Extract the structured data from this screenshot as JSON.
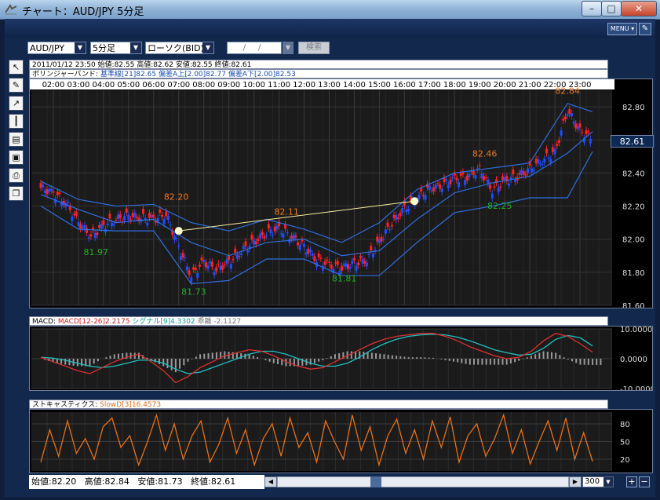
{
  "window": {
    "title": "チャート：AUD/JPY 5分足",
    "buttons": [
      "–",
      "□",
      "✕"
    ]
  },
  "menubar": {
    "menu_label": "MENU ▾",
    "pin": "✎"
  },
  "toolbar": {
    "symbol": "AUD/JPY",
    "timeframe": "5分足",
    "chart_type": "ローソク(BID)",
    "date_placeholder": "/ /",
    "search_label": "検索"
  },
  "sidebar": {
    "tools": [
      "cursor-icon",
      "pencil-icon",
      "trendline-icon",
      "candles-icon",
      "table-icon",
      "window-icon",
      "print-icon",
      "copy-icon"
    ]
  },
  "ohlc_line": "2011/01/12 23:50  始値:82.55  高値:82.62  安値:82.55  終値:82.61",
  "bb_line": {
    "name": "ボリンジャーバンド:",
    "mid": "基準線[21]82.65",
    "upper": "偏差A上[2.00]82.77",
    "lower": "偏差A下[2.00]82.53"
  },
  "current_price": "82.61",
  "macd_line": {
    "name": "MACD:",
    "macd": "MACD[12-26]2.2175",
    "signal": "シグナル[9]4.3302",
    "diff": "乖離 -2.1127"
  },
  "stoch_line": {
    "name": "ストキャスティクス:",
    "slowd": "SlowD[3]16.4573"
  },
  "status": {
    "open": "始値:82.20",
    "high": "高値:82.84",
    "low": "安値:81.73",
    "close": "終値:82.61"
  },
  "zoom_value": "300",
  "colors": {
    "up": "#1e4dff",
    "down": "#ff2020",
    "band": "#2f6fe0",
    "macd": "#e03030",
    "signal": "#20c0c0",
    "stoch": "#e8701a",
    "high_label": "#f07a20",
    "low_label": "#22b022"
  },
  "chart_data": [
    {
      "type": "line",
      "title": "AUD/JPY 5分足",
      "x_tick_labels": [
        "02:00",
        "03:00",
        "04:00",
        "05:00",
        "06:00",
        "07:00",
        "08:00",
        "09:00",
        "10:00",
        "11:00",
        "12:00",
        "13:00",
        "14:00",
        "15:00",
        "16:00",
        "17:00",
        "18:00",
        "19:00",
        "20:00",
        "21:00",
        "22:00",
        "23:00"
      ],
      "y_tick_labels": [
        "82.80",
        "82.60",
        "82.40",
        "82.20",
        "82.00",
        "81.80",
        "81.60"
      ],
      "ylim": [
        81.6,
        82.9
      ],
      "series": [
        {
          "name": "終値",
          "x": [
            1.5,
            2,
            2.5,
            3,
            3.5,
            4,
            4.5,
            5,
            5.5,
            6,
            6.5,
            7,
            7.5,
            8,
            8.5,
            9,
            9.5,
            10,
            10.5,
            11,
            11.5,
            12,
            12.5,
            13,
            13.5,
            14,
            14.5,
            15,
            15.5,
            16,
            16.5,
            17,
            17.5,
            18,
            18.5,
            19,
            19.5,
            20,
            20.5,
            21,
            21.5,
            22,
            22.5,
            23,
            23.5
          ],
          "values": [
            82.31,
            82.28,
            82.22,
            82.1,
            82.02,
            82.08,
            82.12,
            82.14,
            82.13,
            82.12,
            82.15,
            81.95,
            81.78,
            81.86,
            81.82,
            81.86,
            81.93,
            81.98,
            82.04,
            82.06,
            82.02,
            81.95,
            81.88,
            81.84,
            81.83,
            81.85,
            81.88,
            81.98,
            82.1,
            82.18,
            82.25,
            82.3,
            82.33,
            82.36,
            82.38,
            82.42,
            82.3,
            82.35,
            82.38,
            82.42,
            82.48,
            82.52,
            82.78,
            82.65,
            82.61
          ]
        },
        {
          "name": "基準線",
          "x": [
            1.5,
            3,
            4.5,
            6,
            7.5,
            9,
            10.5,
            12,
            13.5,
            15,
            16.5,
            18,
            19.5,
            21,
            22.5,
            23.5
          ],
          "values": [
            82.27,
            82.18,
            82.1,
            82.12,
            81.98,
            81.9,
            81.98,
            82.0,
            81.9,
            81.93,
            82.12,
            82.28,
            82.34,
            82.38,
            82.52,
            82.65
          ]
        },
        {
          "name": "偏差A上",
          "x": [
            1.5,
            3,
            4.5,
            6,
            7.5,
            9,
            10.5,
            12,
            13.5,
            15,
            16.5,
            18,
            19.5,
            21,
            22.5,
            23.5
          ],
          "values": [
            82.35,
            82.24,
            82.2,
            82.21,
            82.1,
            82.05,
            82.12,
            82.06,
            81.98,
            82.1,
            82.3,
            82.4,
            82.43,
            82.46,
            82.82,
            82.77
          ]
        },
        {
          "name": "偏差A下",
          "x": [
            1.5,
            3,
            4.5,
            6,
            7.5,
            9,
            10.5,
            12,
            13.5,
            15,
            16.5,
            18,
            19.5,
            21,
            22.5,
            23.5
          ],
          "values": [
            82.2,
            82.06,
            82.05,
            82.05,
            81.73,
            81.75,
            81.88,
            81.88,
            81.78,
            81.78,
            81.98,
            82.16,
            82.2,
            82.25,
            82.25,
            82.53
          ]
        }
      ],
      "annotations": [
        {
          "text": "82.20",
          "x": 6.9,
          "y": 82.2,
          "kind": "high"
        },
        {
          "text": "82.11",
          "x": 11.3,
          "y": 82.11,
          "kind": "high"
        },
        {
          "text": "82.46",
          "x": 19.2,
          "y": 82.46,
          "kind": "high"
        },
        {
          "text": "82.84",
          "x": 22.5,
          "y": 82.84,
          "kind": "high"
        },
        {
          "text": "81.97",
          "x": 3.7,
          "y": 81.97,
          "kind": "low"
        },
        {
          "text": "81.73",
          "x": 7.6,
          "y": 81.73,
          "kind": "low"
        },
        {
          "text": "81.81",
          "x": 13.6,
          "y": 81.81,
          "kind": "low"
        },
        {
          "text": "82.25",
          "x": 19.8,
          "y": 82.25,
          "kind": "low"
        }
      ],
      "trendline": {
        "x": [
          7.0,
          16.4
        ],
        "y": [
          82.05,
          82.23
        ]
      }
    },
    {
      "type": "line",
      "title": "MACD",
      "y_tick_labels": [
        "10.0000",
        "0.0000",
        "-10.0000"
      ],
      "ylim": [
        -10,
        10
      ],
      "series": [
        {
          "name": "MACD",
          "values": [
            0.5,
            -1,
            -2.5,
            -4,
            -5,
            -3,
            -1,
            0.5,
            1.5,
            -1,
            -4,
            -8,
            -6,
            -3,
            -1,
            1,
            2,
            3,
            2.5,
            1,
            -1,
            -2.5,
            -3.5,
            -3,
            -1,
            1,
            3,
            5,
            6.5,
            7.5,
            8,
            8.5,
            8.5,
            7.5,
            6,
            4,
            2.5,
            1,
            0,
            0.5,
            2.5,
            6,
            8.5,
            7.5,
            5,
            2.2
          ]
        },
        {
          "name": "シグナル",
          "values": [
            0.5,
            0.2,
            -0.5,
            -1.5,
            -2.5,
            -3,
            -2.5,
            -1.5,
            -0.5,
            -0.5,
            -1.5,
            -3.5,
            -5,
            -4.5,
            -3,
            -1.5,
            0,
            1.5,
            2.5,
            2.5,
            1.5,
            0,
            -1.5,
            -2.5,
            -2.5,
            -1.5,
            0.5,
            3,
            5,
            6.5,
            7.5,
            8,
            8.2,
            8,
            7.2,
            6,
            4.5,
            3,
            2,
            1.2,
            1.5,
            3.5,
            6.5,
            7.8,
            7,
            4.3
          ]
        }
      ]
    },
    {
      "type": "line",
      "title": "ストキャスティクス",
      "y_tick_labels": [
        "80",
        "50",
        "20"
      ],
      "ylim": [
        0,
        100
      ],
      "series": [
        {
          "name": "SlowD",
          "values": [
            15,
            70,
            25,
            85,
            30,
            55,
            20,
            75,
            90,
            40,
            60,
            10,
            50,
            95,
            35,
            80,
            20,
            60,
            85,
            15,
            45,
            90,
            30,
            70,
            10,
            55,
            80,
            25,
            90,
            40,
            65,
            15,
            85,
            50,
            20,
            95,
            35,
            75,
            10,
            60,
            88,
            30,
            70,
            20,
            85,
            40,
            92,
            15,
            60,
            80,
            25,
            55,
            95,
            30,
            70,
            12,
            50,
            85,
            35,
            90,
            20,
            65,
            16
          ]
        }
      ]
    }
  ]
}
